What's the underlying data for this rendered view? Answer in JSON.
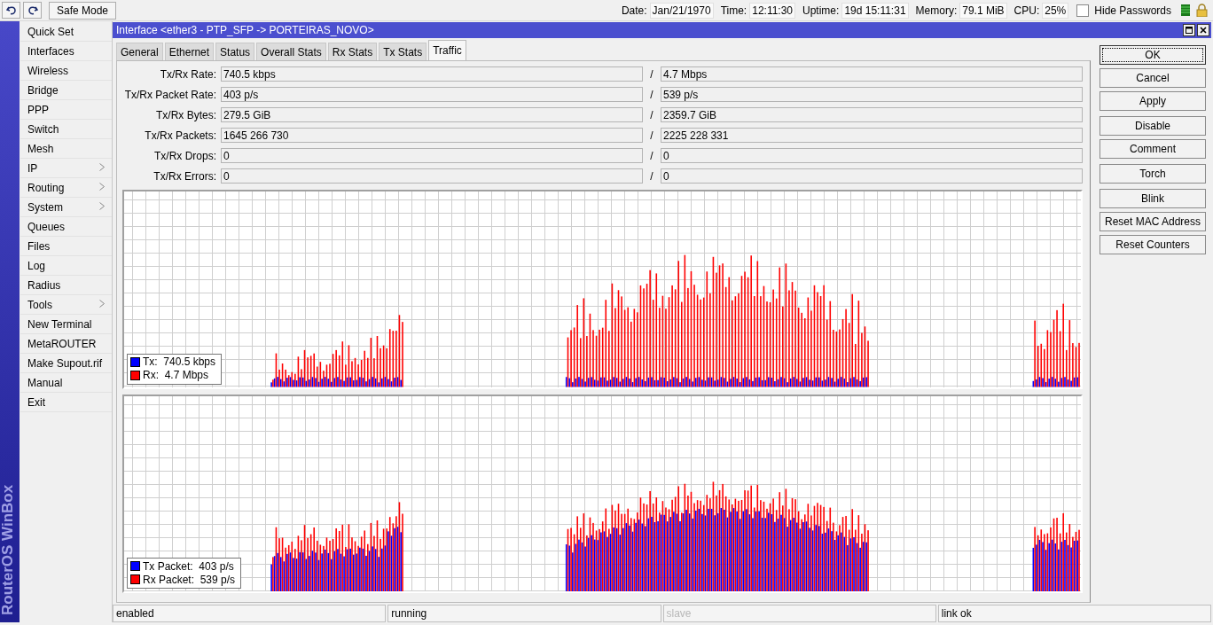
{
  "toolbar": {
    "safe_mode": "Safe Mode",
    "status": [
      {
        "label": "Date:",
        "value": "Jan/21/1970"
      },
      {
        "label": "Time:",
        "value": "12:11:30"
      },
      {
        "label": "Uptime:",
        "value": "19d 15:11:31"
      },
      {
        "label": "Memory:",
        "value": "79.1 MiB"
      },
      {
        "label": "CPU:",
        "value": "25%"
      }
    ],
    "hide_passwords": {
      "label": "Hide Passwords",
      "checked": false
    }
  },
  "sidebar": {
    "brand": "RouterOS WinBox",
    "items": [
      {
        "label": "Quick Set",
        "submenu": false
      },
      {
        "label": "Interfaces",
        "submenu": false
      },
      {
        "label": "Wireless",
        "submenu": false
      },
      {
        "label": "Bridge",
        "submenu": false
      },
      {
        "label": "PPP",
        "submenu": false
      },
      {
        "label": "Switch",
        "submenu": false
      },
      {
        "label": "Mesh",
        "submenu": false
      },
      {
        "label": "IP",
        "submenu": true
      },
      {
        "label": "Routing",
        "submenu": true
      },
      {
        "label": "System",
        "submenu": true
      },
      {
        "label": "Queues",
        "submenu": false
      },
      {
        "label": "Files",
        "submenu": false
      },
      {
        "label": "Log",
        "submenu": false
      },
      {
        "label": "Radius",
        "submenu": false
      },
      {
        "label": "Tools",
        "submenu": true
      },
      {
        "label": "New Terminal",
        "submenu": false
      },
      {
        "label": "MetaROUTER",
        "submenu": false
      },
      {
        "label": "Make Supout.rif",
        "submenu": false
      },
      {
        "label": "Manual",
        "submenu": false
      },
      {
        "label": "Exit",
        "submenu": false
      }
    ]
  },
  "window": {
    "title": "Interface <ether3 - PTP_SFP -> PORTEIRAS_NOVO>",
    "tabs": [
      {
        "label": "General",
        "selected": false
      },
      {
        "label": "Ethernet",
        "selected": false
      },
      {
        "label": "Status",
        "selected": false
      },
      {
        "label": "Overall Stats",
        "selected": false
      },
      {
        "label": "Rx Stats",
        "selected": false
      },
      {
        "label": "Tx Stats",
        "selected": false
      },
      {
        "label": "Traffic",
        "selected": true
      }
    ],
    "fields": [
      {
        "label": "Tx/Rx Rate:",
        "tx": "740.5 kbps",
        "separator": "/",
        "rx": "4.7 Mbps"
      },
      {
        "label": "Tx/Rx Packet Rate:",
        "tx": "403 p/s",
        "separator": "/",
        "rx": "539 p/s"
      },
      {
        "label": "Tx/Rx Bytes:",
        "tx": "279.5 GiB",
        "separator": "/",
        "rx": "2359.7 GiB"
      },
      {
        "label": "Tx/Rx Packets:",
        "tx": "1645 266 730",
        "separator": "/",
        "rx": "2225 228 331"
      },
      {
        "label": "Tx/Rx Drops:",
        "tx": "0",
        "separator": "/",
        "rx": "0"
      },
      {
        "label": "Tx/Rx Errors:",
        "tx": "0",
        "separator": "/",
        "rx": "0"
      }
    ],
    "graphs": [
      {
        "kind": "rate",
        "legend": [
          {
            "label": "Tx:  740.5 kbps",
            "color": "#0000ff"
          },
          {
            "label": "Rx:  4.7 Mbps",
            "color": "#ff0000"
          }
        ]
      },
      {
        "kind": "packets",
        "legend": [
          {
            "label": "Tx Packet:  403 p/s",
            "color": "#0000ff"
          },
          {
            "label": "Rx Packet:  539 p/s",
            "color": "#ff0000"
          }
        ]
      }
    ],
    "button_groups": [
      [
        {
          "label": "OK",
          "focused": true
        },
        {
          "label": "Cancel",
          "focused": false
        },
        {
          "label": "Apply",
          "focused": false
        }
      ],
      [
        {
          "label": "Disable",
          "focused": false
        },
        {
          "label": "Comment",
          "focused": false
        }
      ],
      [
        {
          "label": "Torch",
          "focused": false
        }
      ],
      [
        {
          "label": "Blink",
          "focused": false
        },
        {
          "label": "Reset MAC Address",
          "focused": false
        },
        {
          "label": "Reset Counters",
          "focused": false
        }
      ]
    ],
    "status_bar": [
      {
        "text": "enabled",
        "disabled": false
      },
      {
        "text": "running",
        "disabled": false
      },
      {
        "text": "slave",
        "disabled": true
      },
      {
        "text": "link ok",
        "disabled": false
      }
    ]
  }
}
